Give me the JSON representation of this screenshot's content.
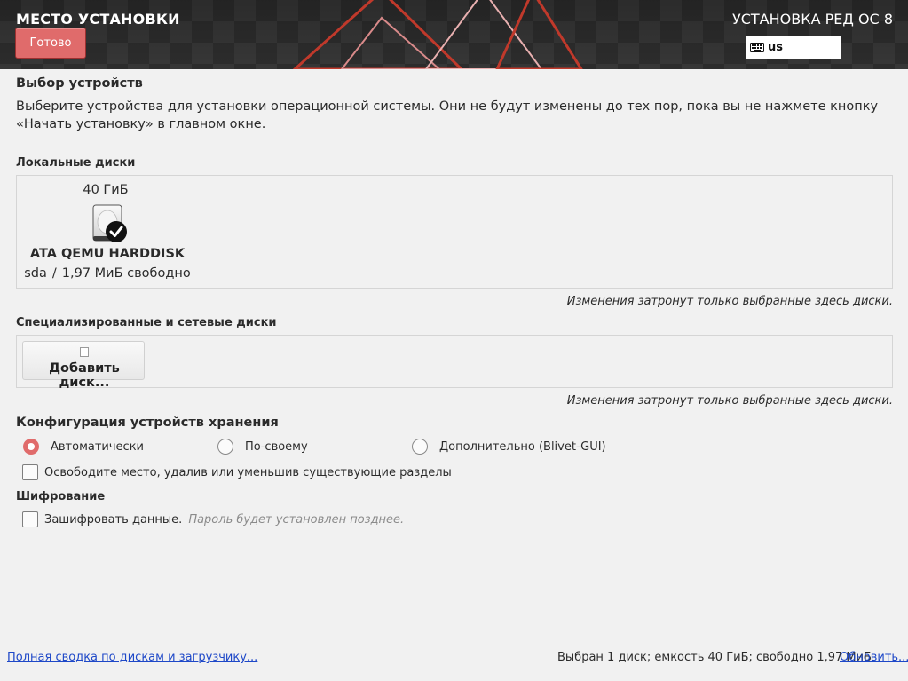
{
  "header": {
    "spoke_title": "МЕСТО УСТАНОВКИ",
    "done_label": "Готово",
    "product_title": "УСТАНОВКА РЕД ОС 8",
    "keyboard_layout": "us",
    "accent_color": "#e06b6b"
  },
  "device_selection": {
    "title": "Выбор устройств",
    "description": "Выберите устройства для установки операционной системы. Они не будут изменены до тех пор, пока вы не нажмете кнопку «Начать установку» в главном окне."
  },
  "local_disks": {
    "title": "Локальные диски",
    "disks": [
      {
        "size": "40 ГиБ",
        "name": "ATA QEMU HARDDISK",
        "device": "sda",
        "separator": "/",
        "free": "1,97 МиБ свободно",
        "selected": true,
        "icon": "hard-disk-icon"
      }
    ],
    "hint": "Изменения затронут только выбранные здесь диски."
  },
  "network_disks": {
    "title": "Специализированные и сетевые диски",
    "add_label": "Добавить диск...",
    "hint": "Изменения затронут только выбранные здесь диски."
  },
  "storage_config": {
    "title": "Конфигурация устройств хранения",
    "options": [
      {
        "label": "Автоматически",
        "selected": true
      },
      {
        "label": "По-своему",
        "selected": false
      },
      {
        "label": "Дополнительно (Blivet-GUI)",
        "selected": false
      }
    ],
    "reclaim_label": "Освободите место, удалив или уменьшив существующие разделы",
    "reclaim_checked": false
  },
  "encryption": {
    "title": "Шифрование",
    "encrypt_label": "Зашифровать данные.",
    "encrypt_note": "Пароль будет установлен позднее.",
    "encrypt_checked": false
  },
  "footer": {
    "summary_link": "Полная сводка по дискам и загрузчику...",
    "status": "Выбран 1 диск; емкость 40 ГиБ; свободно 1,97 МиБ",
    "refresh_link": "Обновить..."
  }
}
